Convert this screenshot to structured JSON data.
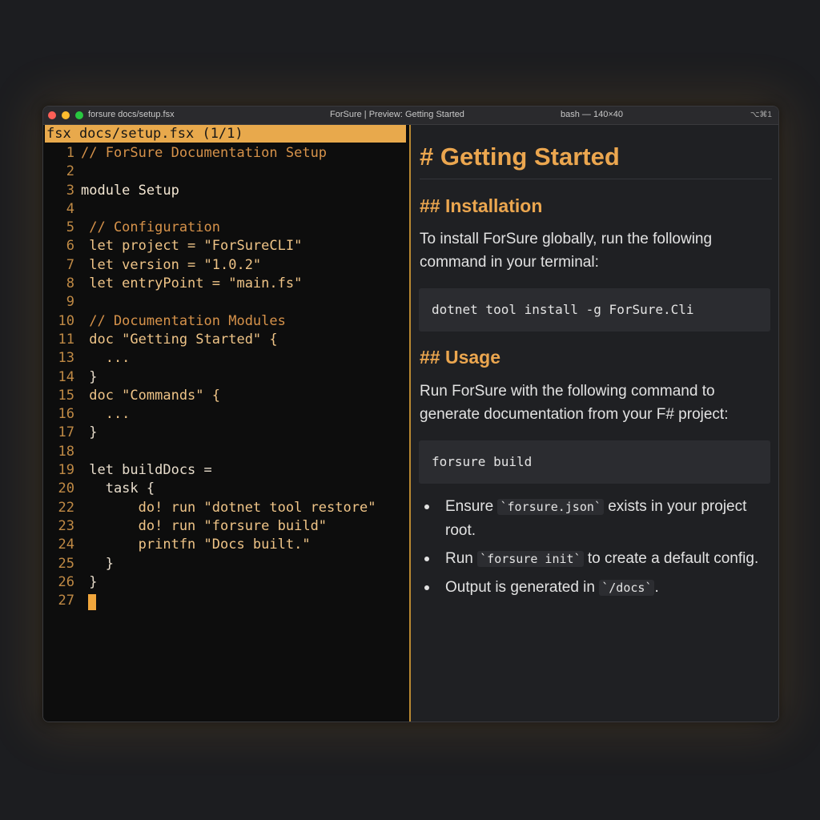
{
  "titlebar": {
    "left": "forsure docs/setup.fsx",
    "center": "ForSure | Preview: Getting Started",
    "right": "bash — 140×40",
    "keys": "⌥⌘1"
  },
  "editor": {
    "status": "fsx docs/setup.fsx (1/1)",
    "lines": [
      {
        "n": "1",
        "text": "// ForSure Documentation Setup",
        "kind": "comment"
      },
      {
        "n": "2",
        "text": "",
        "kind": "plain"
      },
      {
        "n": "3",
        "text": "module Setup",
        "kind": "keyword"
      },
      {
        "n": "4",
        "text": "",
        "kind": "plain"
      },
      {
        "n": "5",
        "text": " // Configuration",
        "kind": "comment"
      },
      {
        "n": "6",
        "text": " let project = \"ForSureCLI\"",
        "kind": "string"
      },
      {
        "n": "7",
        "text": " let version = \"1.0.2\"",
        "kind": "string"
      },
      {
        "n": "8",
        "text": " let entryPoint = \"main.fs\"",
        "kind": "string"
      },
      {
        "n": "9",
        "text": "",
        "kind": "plain"
      },
      {
        "n": "10",
        "text": " // Documentation Modules",
        "kind": "comment"
      },
      {
        "n": "11",
        "text": " doc \"Getting Started\" {",
        "kind": "string"
      },
      {
        "n": "13",
        "text": "   ...",
        "kind": "string"
      },
      {
        "n": "14",
        "text": " }",
        "kind": "plain"
      },
      {
        "n": "15",
        "text": " doc \"Commands\" {",
        "kind": "string"
      },
      {
        "n": "16",
        "text": "   ...",
        "kind": "string"
      },
      {
        "n": "17",
        "text": " }",
        "kind": "plain"
      },
      {
        "n": "18",
        "text": "",
        "kind": "plain"
      },
      {
        "n": "19",
        "text": " let buildDocs =",
        "kind": "plain"
      },
      {
        "n": "20",
        "text": "   task {",
        "kind": "plain"
      },
      {
        "n": "22",
        "text": "       do! run \"dotnet tool restore\"",
        "kind": "string"
      },
      {
        "n": "23",
        "text": "       do! run \"forsure build\"",
        "kind": "string"
      },
      {
        "n": "24",
        "text": "       printfn \"Docs built.\"",
        "kind": "string"
      },
      {
        "n": "25",
        "text": "   }",
        "kind": "plain"
      },
      {
        "n": "26",
        "text": " }",
        "kind": "plain"
      },
      {
        "n": "27",
        "text": "",
        "kind": "plain"
      }
    ]
  },
  "preview": {
    "h1": "# Getting Started",
    "install_heading": "## Installation",
    "install_text": "To install ForSure globally, run the following command in your terminal:",
    "install_code": "dotnet tool install -g ForSure.Cli",
    "usage_heading": "## Usage",
    "usage_text": "Run ForSure with the following command to generate documentation from your F# project:",
    "usage_code": "forsure build",
    "bullets": [
      {
        "before": "Ensure ",
        "code": "`forsure.json`",
        "after": " exists in your project root."
      },
      {
        "before": "Run ",
        "code": "`forsure init`",
        "after": " to create a default config."
      },
      {
        "before": "Output is generated in ",
        "code": "`/docs`",
        "after": "."
      }
    ]
  }
}
